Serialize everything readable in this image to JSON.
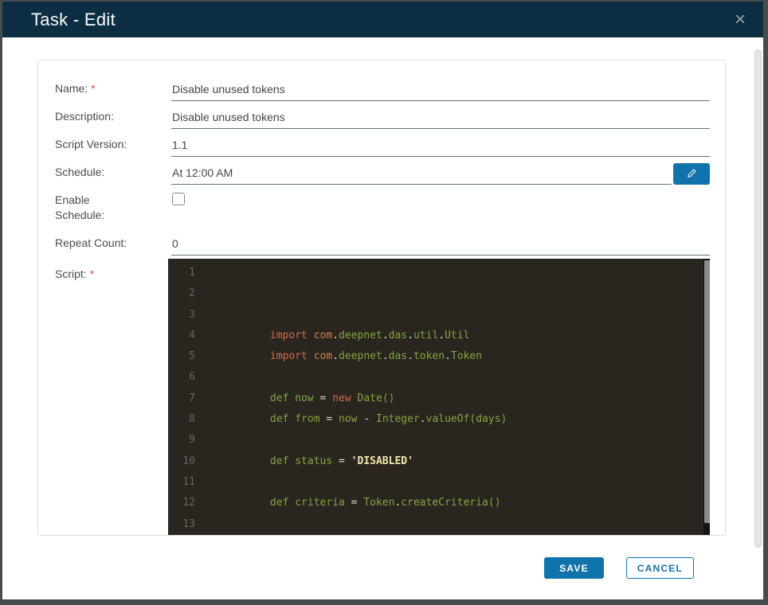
{
  "colors": {
    "backdrop": "#464b4e",
    "header_bg": "#0d2e42",
    "accent": "#1173ab",
    "editor_bg": "#2b2520",
    "required_marker_color": "#e25549"
  },
  "header": {
    "title": "Task - Edit",
    "close_icon": "×"
  },
  "form": {
    "required_marker": "*",
    "rows": [
      {
        "label": "Name:",
        "required": true,
        "type": "input",
        "value": "Disable unused tokens"
      },
      {
        "label": "Description:",
        "required": false,
        "type": "input",
        "value": "Disable unused tokens"
      },
      {
        "label": "Script Version:",
        "required": false,
        "type": "input",
        "value": "1.1"
      },
      {
        "label": "Schedule:",
        "required": false,
        "type": "input-edit",
        "value": "At 12:00 AM",
        "edit_icon": "pencil-icon"
      },
      {
        "label": "Enable Schedule:",
        "required": false,
        "type": "checkbox",
        "checked": false
      },
      {
        "label": "Repeat Count:",
        "required": false,
        "type": "input",
        "value": "0"
      },
      {
        "label": "Script:",
        "required": true,
        "type": "editor"
      }
    ]
  },
  "editor": {
    "indent": "            ",
    "token_colors": {
      "k": "#cf6a4c",
      "o": "#c8834e",
      "g": "#7fa63e",
      "w": "#d8d5cd",
      "s": "#eee8a9"
    },
    "line_number_color": "#6a645f",
    "lines": [
      {
        "num": "1",
        "tokens": []
      },
      {
        "num": "2",
        "tokens": []
      },
      {
        "num": "3",
        "tokens": []
      },
      {
        "num": "4",
        "tokens": [
          [
            "k",
            "import"
          ],
          [
            "w",
            " "
          ],
          [
            "o",
            "com"
          ],
          [
            "w",
            "."
          ],
          [
            "g",
            "deepnet"
          ],
          [
            "w",
            "."
          ],
          [
            "g",
            "das"
          ],
          [
            "w",
            "."
          ],
          [
            "g",
            "util"
          ],
          [
            "w",
            "."
          ],
          [
            "g",
            "Util"
          ]
        ]
      },
      {
        "num": "5",
        "tokens": [
          [
            "k",
            "import"
          ],
          [
            "w",
            " "
          ],
          [
            "o",
            "com"
          ],
          [
            "w",
            "."
          ],
          [
            "g",
            "deepnet"
          ],
          [
            "w",
            "."
          ],
          [
            "g",
            "das"
          ],
          [
            "w",
            "."
          ],
          [
            "g",
            "token"
          ],
          [
            "w",
            "."
          ],
          [
            "g",
            "Token"
          ]
        ]
      },
      {
        "num": "6",
        "tokens": []
      },
      {
        "num": "7",
        "tokens": [
          [
            "g",
            "def now "
          ],
          [
            "w",
            "= "
          ],
          [
            "k",
            "new"
          ],
          [
            "g",
            " Date()"
          ]
        ]
      },
      {
        "num": "8",
        "tokens": [
          [
            "g",
            "def from "
          ],
          [
            "w",
            "= "
          ],
          [
            "g",
            "now "
          ],
          [
            "w",
            "- "
          ],
          [
            "g",
            "Integer"
          ],
          [
            "w",
            "."
          ],
          [
            "g",
            "valueOf(days)"
          ]
        ]
      },
      {
        "num": "9",
        "tokens": []
      },
      {
        "num": "10",
        "tokens": [
          [
            "g",
            "def status "
          ],
          [
            "w",
            "= "
          ],
          [
            "s",
            "'DISABLED'"
          ]
        ]
      },
      {
        "num": "11",
        "tokens": []
      },
      {
        "num": "12",
        "tokens": [
          [
            "g",
            "def criteria "
          ],
          [
            "w",
            "= "
          ],
          [
            "g",
            "Token"
          ],
          [
            "w",
            "."
          ],
          [
            "g",
            "createCriteria()"
          ]
        ]
      },
      {
        "num": "13",
        "tokens": []
      }
    ]
  },
  "footer": {
    "save_label": "SAVE",
    "cancel_label": "CANCEL"
  }
}
